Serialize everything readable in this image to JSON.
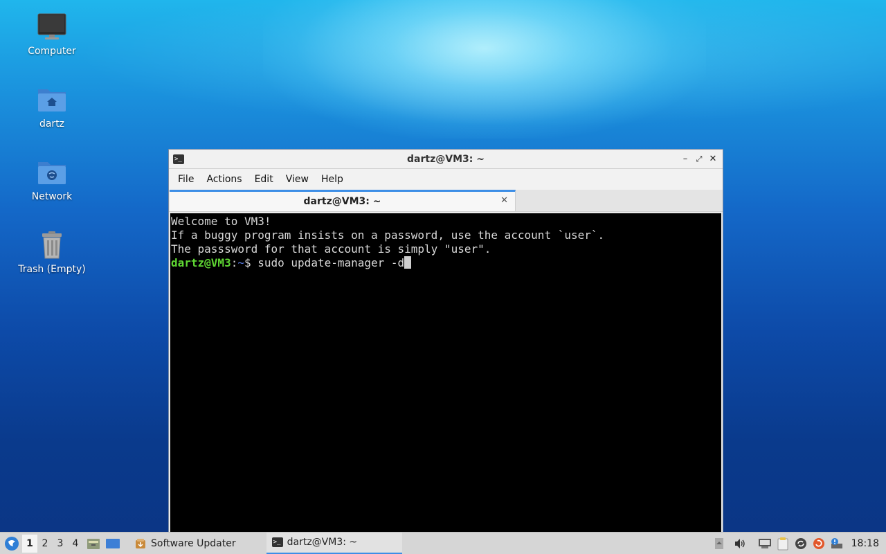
{
  "desktop": {
    "icons": [
      {
        "label": "Computer"
      },
      {
        "label": "dartz"
      },
      {
        "label": "Network"
      },
      {
        "label": "Trash (Empty)"
      }
    ]
  },
  "terminal": {
    "window_title": "dartz@VM3: ~",
    "menu": [
      "File",
      "Actions",
      "Edit",
      "View",
      "Help"
    ],
    "tab_label": "dartz@VM3: ~",
    "lines": [
      "Welcome to VM3!",
      "If a buggy program insists on a password, use the account `user`.",
      "The passsword for that account is simply \"user\".",
      ""
    ],
    "prompt_user": "dartz@VM3",
    "prompt_sep": ":",
    "prompt_path": "~",
    "prompt_symbol": "$ ",
    "command": "sudo update-manager -d"
  },
  "taskbar": {
    "workspaces": [
      "1",
      "2",
      "3",
      "4"
    ],
    "active_workspace": "1",
    "tasks": [
      {
        "label": "Software Updater",
        "icon": "software-updater-icon",
        "active": false
      },
      {
        "label": "dartz@VM3: ~",
        "icon": "terminal-icon",
        "active": true
      }
    ],
    "clock": "18:18"
  },
  "colors": {
    "accent": "#3d8ee6",
    "prompt_user": "#5fd733",
    "prompt_path": "#5b7fe8"
  }
}
